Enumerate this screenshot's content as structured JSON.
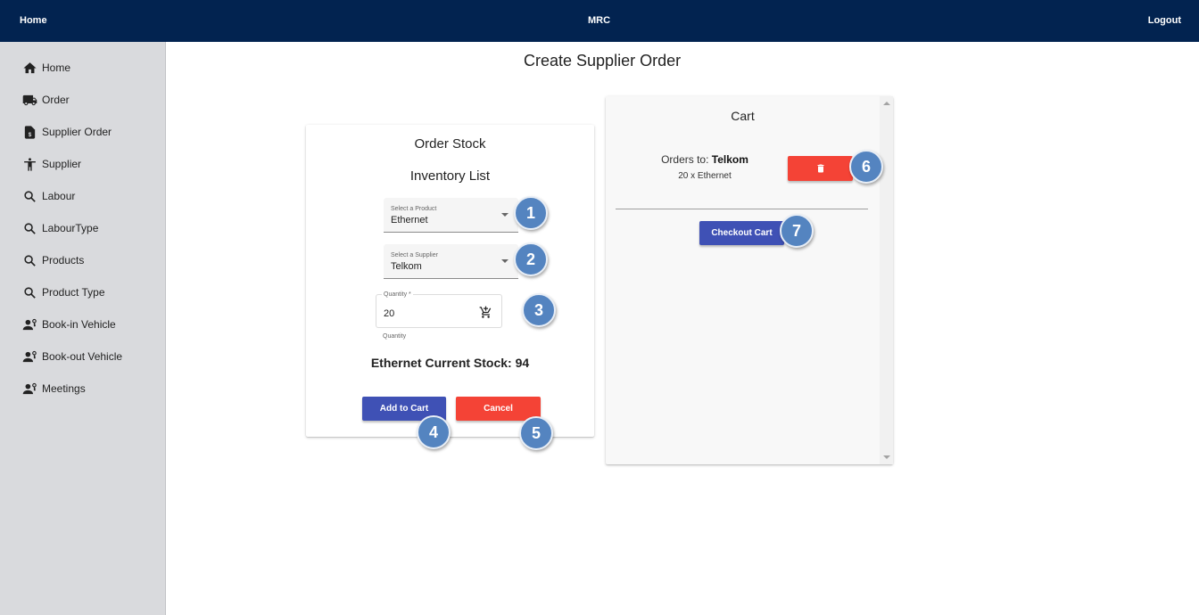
{
  "topbar": {
    "home": "Home",
    "brand": "MRC",
    "logout": "Logout",
    "bg_color": "#022350"
  },
  "sidebar": {
    "items": [
      {
        "label": "Home",
        "icon": "home-icon"
      },
      {
        "label": "Order",
        "icon": "truck-icon"
      },
      {
        "label": "Supplier Order",
        "icon": "invoice-icon"
      },
      {
        "label": "Supplier",
        "icon": "person-icon"
      },
      {
        "label": "Labour",
        "icon": "search-icon"
      },
      {
        "label": "LabourType",
        "icon": "search-icon"
      },
      {
        "label": "Products",
        "icon": "search-icon"
      },
      {
        "label": "Product Type",
        "icon": "search-icon"
      },
      {
        "label": "Book-in Vehicle",
        "icon": "person-key-icon"
      },
      {
        "label": "Book-out Vehicle",
        "icon": "person-key-icon"
      },
      {
        "label": "Meetings",
        "icon": "person-key-icon"
      }
    ]
  },
  "page": {
    "title": "Create Supplier Order"
  },
  "order_card": {
    "heading": "Order Stock",
    "subheading": "Inventory List",
    "product_select": {
      "label": "Select a Product",
      "value": "Ethernet"
    },
    "supplier_select": {
      "label": "Select a Supplier",
      "value": "Telkom"
    },
    "quantity": {
      "label": "Quantity *",
      "value": "20",
      "helper": "Quantity"
    },
    "stock_text": "Ethernet Current Stock: 94",
    "add_label": "Add to Cart",
    "cancel_label": "Cancel"
  },
  "cart": {
    "heading": "Cart",
    "orders_to_prefix": "Orders to:",
    "supplier": "Telkom",
    "item_line": "20 x Ethernet",
    "checkout_label": "Checkout Cart"
  },
  "markers": [
    "1",
    "2",
    "3",
    "4",
    "5",
    "6",
    "7"
  ],
  "colors": {
    "primary": "#3f51b5",
    "danger": "#f44336",
    "marker": "#5484c0"
  }
}
